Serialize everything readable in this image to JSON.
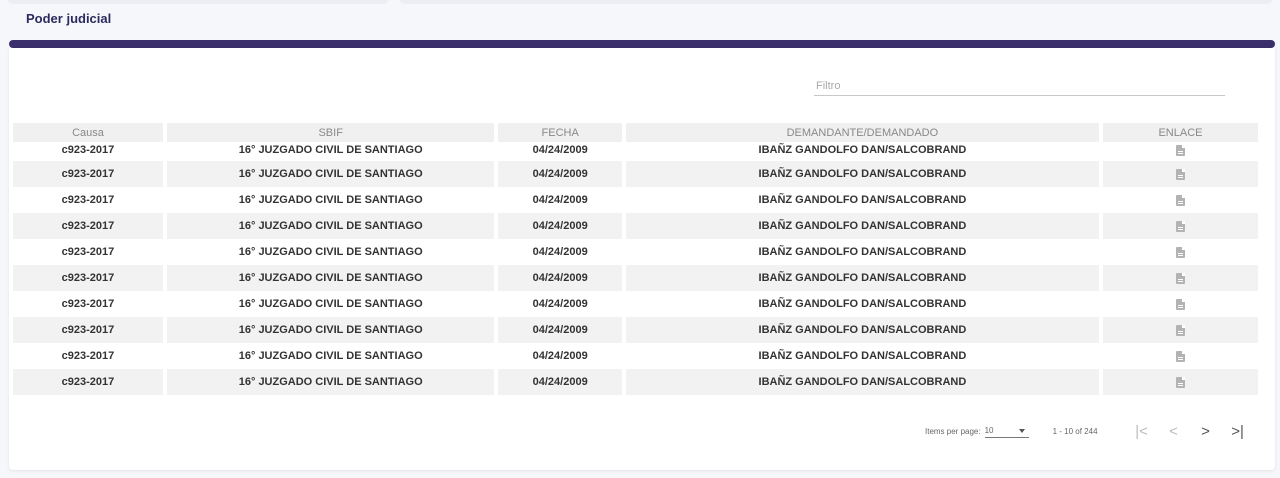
{
  "header": {
    "title": "Poder judicial"
  },
  "filter": {
    "placeholder": "Filtro",
    "value": ""
  },
  "table": {
    "columns": [
      "Causa",
      "SBIF",
      "FECHA",
      "DEMANDANTE/DEMANDADO",
      "ENLACE"
    ],
    "rows": [
      {
        "causa": "c923-2017",
        "sbif": "16° JUZGADO CIVIL DE SANTIAGO",
        "fecha": "04/24/2009",
        "partes": "IBAÑZ GANDOLFO DAN/SALCOBRAND",
        "enlace": "document-icon"
      },
      {
        "causa": "c923-2017",
        "sbif": "16° JUZGADO CIVIL DE SANTIAGO",
        "fecha": "04/24/2009",
        "partes": "IBAÑZ GANDOLFO DAN/SALCOBRAND",
        "enlace": "document-icon"
      },
      {
        "causa": "c923-2017",
        "sbif": "16° JUZGADO CIVIL DE SANTIAGO",
        "fecha": "04/24/2009",
        "partes": "IBAÑZ GANDOLFO DAN/SALCOBRAND",
        "enlace": "document-icon"
      },
      {
        "causa": "c923-2017",
        "sbif": "16° JUZGADO CIVIL DE SANTIAGO",
        "fecha": "04/24/2009",
        "partes": "IBAÑZ GANDOLFO DAN/SALCOBRAND",
        "enlace": "document-icon"
      },
      {
        "causa": "c923-2017",
        "sbif": "16° JUZGADO CIVIL DE SANTIAGO",
        "fecha": "04/24/2009",
        "partes": "IBAÑZ GANDOLFO DAN/SALCOBRAND",
        "enlace": "document-icon"
      },
      {
        "causa": "c923-2017",
        "sbif": "16° JUZGADO CIVIL DE SANTIAGO",
        "fecha": "04/24/2009",
        "partes": "IBAÑZ GANDOLFO DAN/SALCOBRAND",
        "enlace": "document-icon"
      },
      {
        "causa": "c923-2017",
        "sbif": "16° JUZGADO CIVIL DE SANTIAGO",
        "fecha": "04/24/2009",
        "partes": "IBAÑZ GANDOLFO DAN/SALCOBRAND",
        "enlace": "document-icon"
      },
      {
        "causa": "c923-2017",
        "sbif": "16° JUZGADO CIVIL DE SANTIAGO",
        "fecha": "04/24/2009",
        "partes": "IBAÑZ GANDOLFO DAN/SALCOBRAND",
        "enlace": "document-icon"
      },
      {
        "causa": "c923-2017",
        "sbif": "16° JUZGADO CIVIL DE SANTIAGO",
        "fecha": "04/24/2009",
        "partes": "IBAÑZ GANDOLFO DAN/SALCOBRAND",
        "enlace": "document-icon"
      },
      {
        "causa": "c923-2017",
        "sbif": "16° JUZGADO CIVIL DE SANTIAGO",
        "fecha": "04/24/2009",
        "partes": "IBAÑZ GANDOLFO DAN/SALCOBRAND",
        "enlace": "document-icon"
      }
    ]
  },
  "paginator": {
    "items_per_page_label": "Items per page:",
    "page_size": "10",
    "range_label": "1 - 10 of 244",
    "first_icon": "first-page-icon",
    "prev_icon": "chevron-left-icon",
    "next_icon": "chevron-right-icon",
    "last_icon": "last-page-icon"
  },
  "colors": {
    "accent": "#3b2f6b",
    "title": "#2d2a5e",
    "row_alt": "#f2f2f2"
  }
}
